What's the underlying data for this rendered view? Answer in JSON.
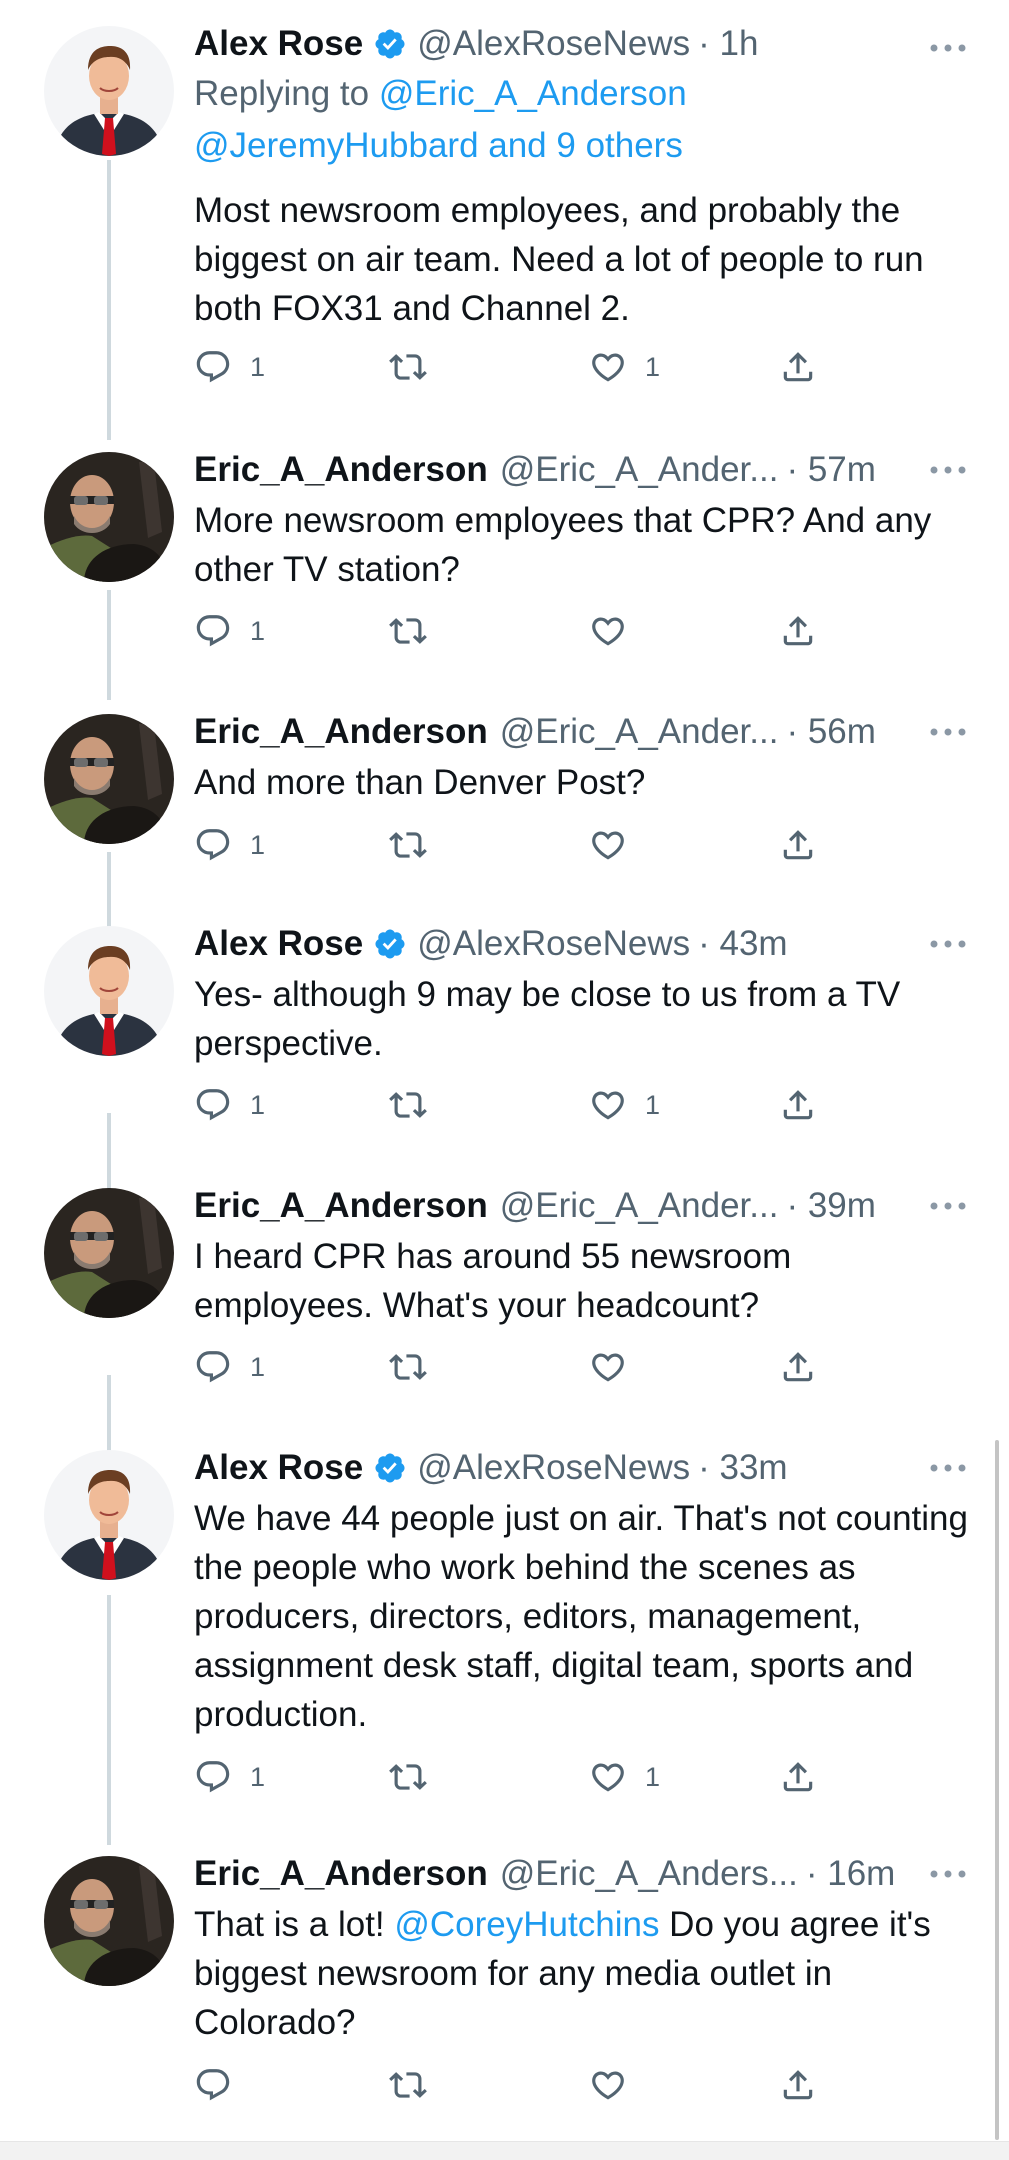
{
  "colors": {
    "link": "#1d9bf0",
    "secondary": "#536471",
    "thread_line": "#cfd9de"
  },
  "tweets": [
    {
      "name": "Alex Rose",
      "verified": true,
      "handle": "@AlexRoseNews",
      "time": "· 1h",
      "replying_label": "Replying to ",
      "replying_user": "@Eric_A_Anderson",
      "replying_more": "@JeremyHubbard and 9 others",
      "text": "Most newsroom employees, and probably the biggest on air team. Need a lot of people to run both FOX31 and Channel 2.",
      "reply_count": "1",
      "like_count": "1"
    },
    {
      "name": "Eric_A_Anderson",
      "handle": "@Eric_A_Ander...",
      "time": "· 57m",
      "text": "More newsroom employees that CPR? And any other TV station?",
      "reply_count": "1",
      "like_count": ""
    },
    {
      "name": "Eric_A_Anderson",
      "handle": "@Eric_A_Ander...",
      "time": "· 56m",
      "text": "And more than Denver Post?",
      "reply_count": "1",
      "like_count": ""
    },
    {
      "name": "Alex Rose",
      "verified": true,
      "handle": "@AlexRoseNews",
      "time": "· 43m",
      "text": "Yes- although 9 may be close to us from a TV perspective.",
      "reply_count": "1",
      "like_count": "1"
    },
    {
      "name": "Eric_A_Anderson",
      "handle": "@Eric_A_Ander...",
      "time": "· 39m",
      "text": "I heard CPR has around 55 newsroom employees. What's your headcount?",
      "reply_count": "1",
      "like_count": ""
    },
    {
      "name": "Alex Rose",
      "verified": true,
      "handle": "@AlexRoseNews",
      "time": "· 33m",
      "text": "We have 44 people just on air. That's not counting the people who work behind the scenes as producers, directors, editors, management, assignment desk staff, digital team, sports and production.",
      "reply_count": "1",
      "like_count": "1"
    },
    {
      "name": "Eric_A_Anderson",
      "handle": "@Eric_A_Anders...",
      "time": "· 16m",
      "text_before": "That is a lot! ",
      "mention": "@CoreyHutchins",
      "text_after": " Do you agree it's biggest newsroom for any media outlet in Colorado?",
      "reply_count": "",
      "like_count": ""
    }
  ]
}
